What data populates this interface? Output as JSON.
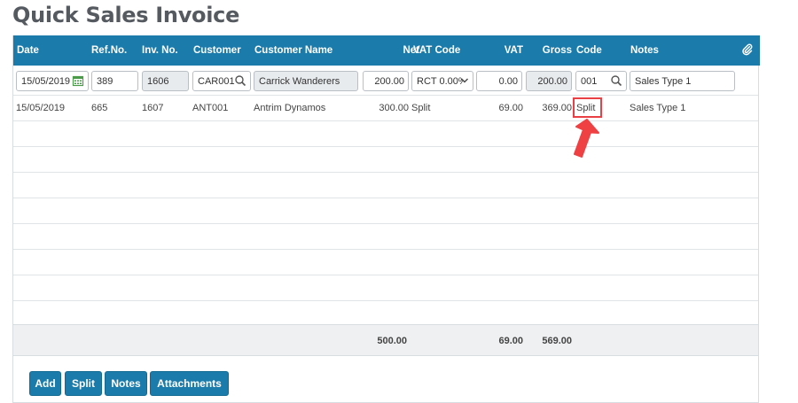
{
  "page": {
    "title": "Quick Sales Invoice"
  },
  "columns": {
    "date": "Date",
    "ref": "Ref.No.",
    "inv": "Inv. No.",
    "customer": "Customer",
    "customer_name": "Customer Name",
    "net": "Net",
    "vat_code": "VAT Code",
    "vat": "VAT",
    "gross": "Gross",
    "code": "Code",
    "notes": "Notes",
    "attach_icon": "paperclip-icon"
  },
  "input_row": {
    "date": "15/05/2019",
    "ref": "389",
    "inv": "1606",
    "customer": "CAR001",
    "customer_name": "Carrick Wanderers",
    "net": "200.00",
    "vat_code": "RCT 0.00%",
    "vat": "0.00",
    "gross": "200.00",
    "code": "001",
    "notes": "Sales Type 1"
  },
  "rows": [
    {
      "date": "15/05/2019",
      "ref": "665",
      "inv": "1607",
      "customer": "ANT001",
      "customer_name": "Antrim Dynamos",
      "net": "300.00",
      "vat_code": "Split",
      "vat": "69.00",
      "gross": "369.00",
      "code": "Split",
      "notes": "Sales Type 1"
    }
  ],
  "totals": {
    "net": "500.00",
    "vat": "69.00",
    "gross": "569.00"
  },
  "buttons": {
    "add": "Add",
    "split": "Split",
    "notes": "Notes",
    "attachments": "Attachments"
  },
  "colors": {
    "header": "#1b7bab",
    "highlight": "#e94045"
  }
}
